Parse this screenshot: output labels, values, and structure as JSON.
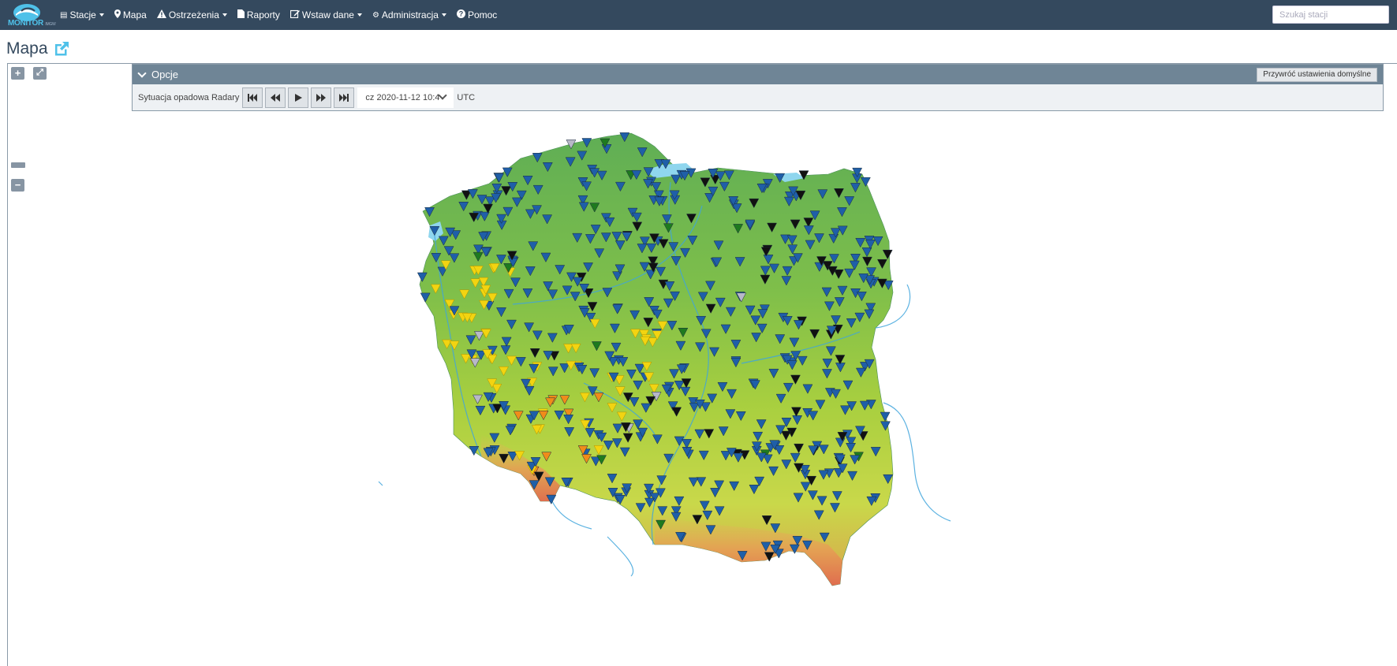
{
  "navbar": {
    "brand": {
      "main": "MONITOR",
      "sub": "IMGW"
    },
    "items": [
      {
        "label": "Stacje",
        "icon": "table-icon",
        "dropdown": true
      },
      {
        "label": "Mapa",
        "icon": "map-marker-icon",
        "dropdown": false
      },
      {
        "label": "Ostrzeżenia",
        "icon": "warning-icon",
        "dropdown": true
      },
      {
        "label": "Raporty",
        "icon": "document-icon",
        "dropdown": false
      },
      {
        "label": "Wstaw dane",
        "icon": "edit-icon",
        "dropdown": true
      },
      {
        "label": "Administracja",
        "icon": "gear-icon",
        "dropdown": true
      },
      {
        "label": "Pomoc",
        "icon": "question-circle-icon",
        "dropdown": false
      }
    ],
    "search_placeholder": "Szukaj stacji"
  },
  "page": {
    "title": "Mapa"
  },
  "map_controls": {
    "zoom_in": "+",
    "fullscreen": "⤢",
    "zoom_out": "−"
  },
  "options": {
    "title": "Opcje",
    "reset_label": "Przywróć ustawienia domyślne",
    "layer_label": "Sytuacja opadowa Radary",
    "date_value": "cz 2020-11-12 10:4",
    "timezone": "UTC"
  },
  "colors": {
    "navbar": "#34495e",
    "accent": "#4fc1e9",
    "marker_blue": "#1f5fa8",
    "marker_black": "#111111",
    "marker_yellow": "#f2d411",
    "marker_orange": "#f08c1a",
    "marker_green": "#1e7a1e",
    "marker_gray": "#b8b8c8"
  }
}
